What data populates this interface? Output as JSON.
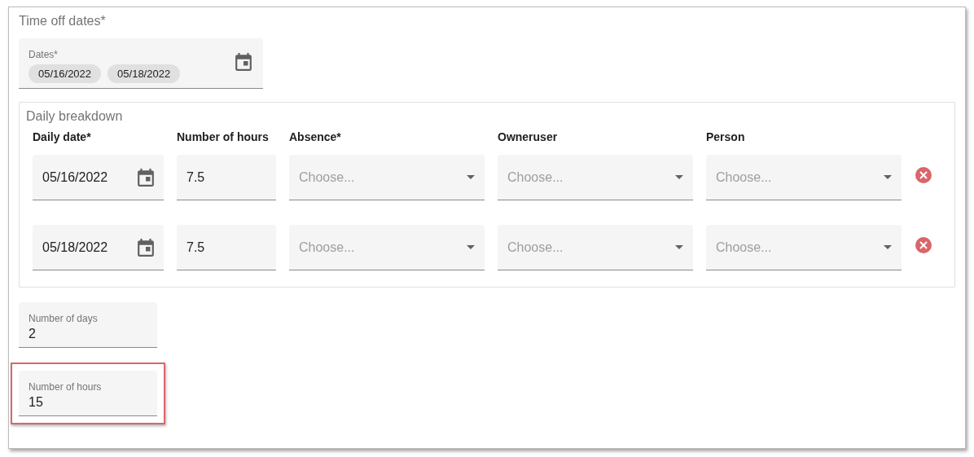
{
  "section_title": "Time off dates*",
  "dates_field": {
    "label": "Dates*",
    "chips": [
      "05/16/2022",
      "05/18/2022"
    ]
  },
  "daily_breakdown": {
    "legend": "Daily breakdown",
    "columns": [
      "Daily date*",
      "Number of hours",
      "Absence*",
      "Owneruser",
      "Person"
    ],
    "rows": [
      {
        "date": "05/16/2022",
        "hours": "7.5",
        "absence": {
          "placeholder": "Choose..."
        },
        "owneruser": {
          "placeholder": "Choose..."
        },
        "person": {
          "placeholder": "Choose..."
        }
      },
      {
        "date": "05/18/2022",
        "hours": "7.5",
        "absence": {
          "placeholder": "Choose..."
        },
        "owneruser": {
          "placeholder": "Choose..."
        },
        "person": {
          "placeholder": "Choose..."
        }
      }
    ]
  },
  "summary_fields": [
    {
      "label": "Number of days",
      "value": "2",
      "highlighted": false
    },
    {
      "label": "Number of hours",
      "value": "15",
      "highlighted": true
    }
  ]
}
